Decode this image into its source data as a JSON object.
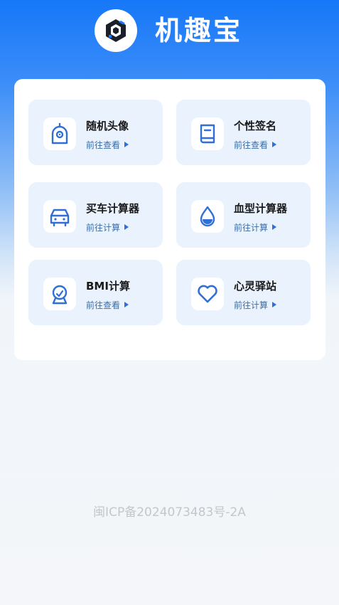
{
  "header": {
    "title": "机趣宝",
    "logo_icon": "cube-logo-icon"
  },
  "cards": [
    {
      "title": "随机头像",
      "link": "前往查看",
      "icon": "avatar-icon"
    },
    {
      "title": "个性签名",
      "link": "前往查看",
      "icon": "book-icon"
    },
    {
      "title": "买车计算器",
      "link": "前往计算",
      "icon": "car-icon"
    },
    {
      "title": "血型计算器",
      "link": "前往计算",
      "icon": "blood-drop-icon"
    },
    {
      "title": "BMI计算",
      "link": "前往查看",
      "icon": "body-scale-icon"
    },
    {
      "title": "心灵驿站",
      "link": "前往计算",
      "icon": "heart-icon"
    }
  ],
  "footer": {
    "icp": "闽ICP备2024073483号-2A"
  },
  "colors": {
    "primary": "#1677f8",
    "card_bg": "#e9f2fd",
    "icon_blue": "#2f6fd6"
  }
}
